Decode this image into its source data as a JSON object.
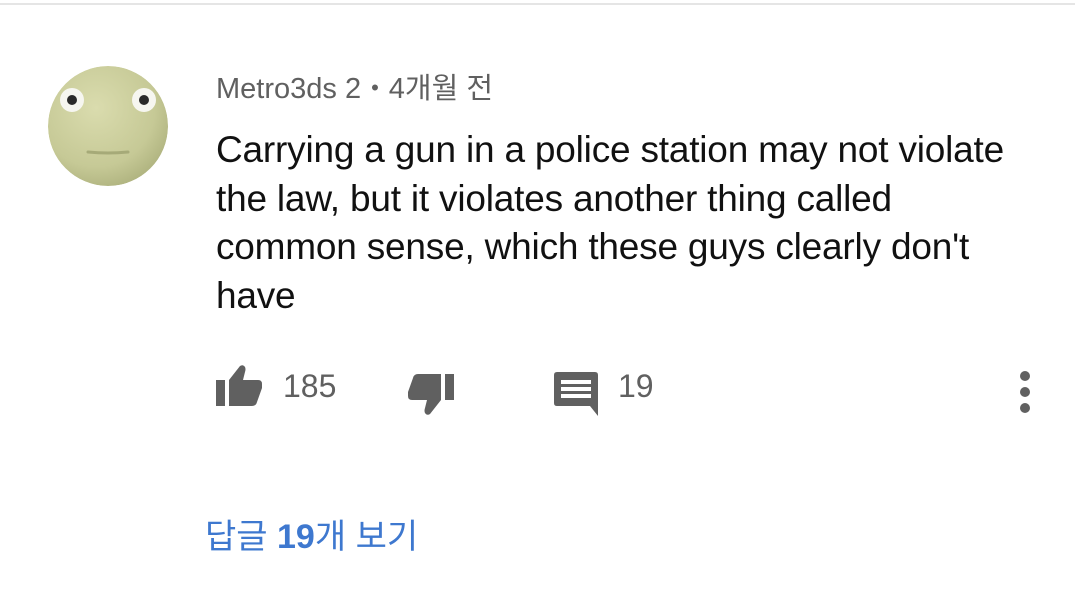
{
  "comment": {
    "author": "Metro3ds 2",
    "separator": "•",
    "time": "4개월 전",
    "text": "Carrying a gun in a police station may not violate the law, but it violates another thing called common sense, which these guys clearly don't have",
    "avatar_icon": "avatar-face-icon",
    "avatar_color": "#c9cc9b"
  },
  "actions": {
    "like_count": "185",
    "reply_count": "19",
    "icons": [
      "thumbs-up-icon",
      "thumbs-down-icon",
      "reply-icon",
      "more-vert-icon"
    ],
    "icon_color": "#606060"
  },
  "replies": {
    "prefix": "답글 ",
    "count": "19",
    "suffix": "개 보기",
    "link_color": "#3e78cf"
  }
}
